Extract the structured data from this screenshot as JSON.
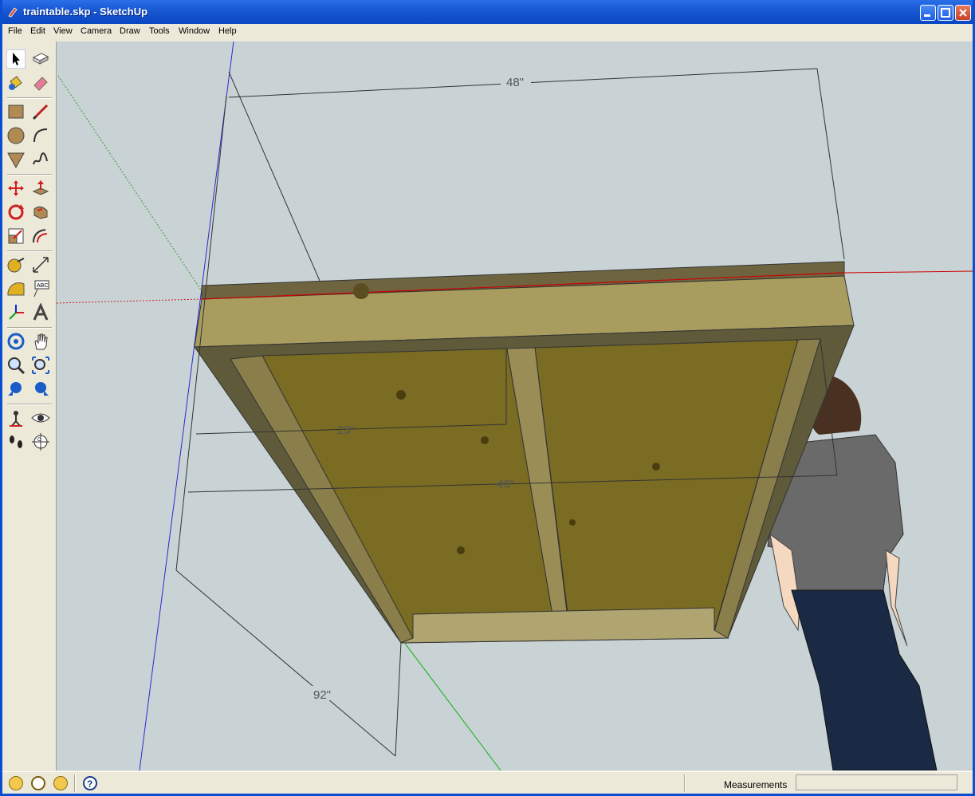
{
  "window": {
    "title": "traintable.skp - SketchUp"
  },
  "menu": [
    "File",
    "Edit",
    "View",
    "Camera",
    "Draw",
    "Tools",
    "Window",
    "Help"
  ],
  "tools": [
    "select-icon",
    "make-component-icon",
    "paint-bucket-icon",
    "eraser-icon",
    "rectangle-icon",
    "line-icon",
    "circle-icon",
    "arc-icon",
    "polygon-icon",
    "freehand-icon",
    "move-icon",
    "push-pull-icon",
    "rotate-icon",
    "follow-me-icon",
    "scale-icon",
    "offset-icon",
    "tape-measure-icon",
    "dimension-icon",
    "protractor-icon",
    "text-icon",
    "axes-icon",
    "3d-text-icon",
    "orbit-icon",
    "pan-icon",
    "zoom-icon",
    "zoom-extents-icon",
    "previous-view-icon",
    "next-view-icon",
    "position-camera-icon",
    "look-around-icon",
    "walk-icon",
    "section-plane-icon"
  ],
  "dimensions": {
    "width_top": "48\"",
    "length_92": "92\"",
    "inner_23": "23\"",
    "inner_46": "46\""
  },
  "status": {
    "measurements_label": "Measurements",
    "measurements_value": ""
  },
  "colors": {
    "sky": "#c9d3d5",
    "wood": "#8a7a3a",
    "plywood": "#7a6b22",
    "red_axis": "#cc0000",
    "green_axis": "#00aa00",
    "blue_axis": "#0000cc"
  }
}
